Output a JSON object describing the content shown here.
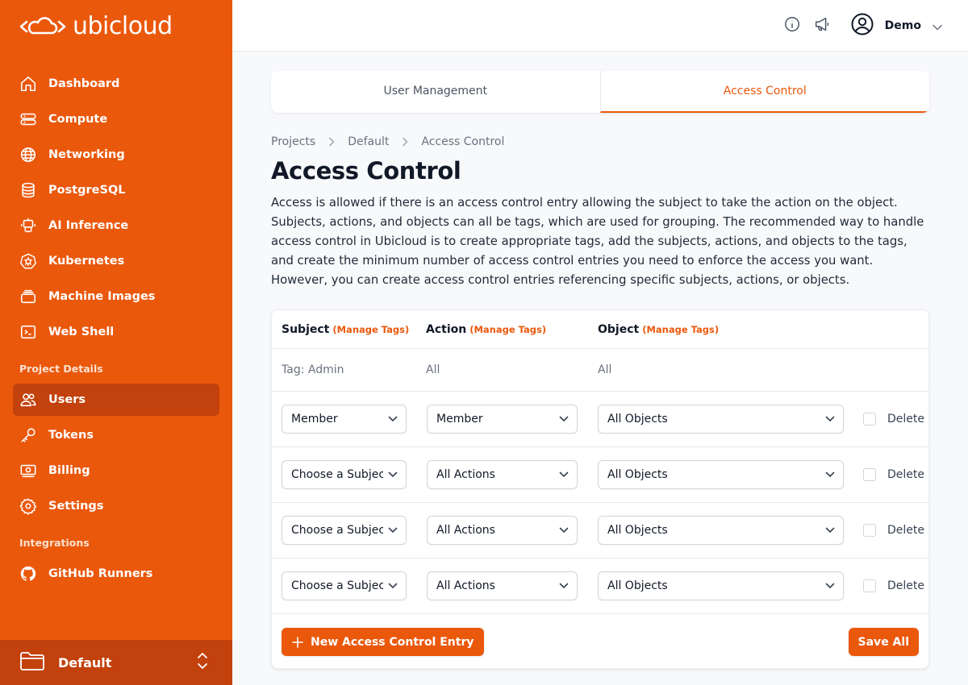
{
  "brand": {
    "name": "ubicloud"
  },
  "sidebar": {
    "items": [
      {
        "label": "Dashboard",
        "icon": "home-icon"
      },
      {
        "label": "Compute",
        "icon": "server-icon"
      },
      {
        "label": "Networking",
        "icon": "globe-icon"
      },
      {
        "label": "PostgreSQL",
        "icon": "database-icon"
      },
      {
        "label": "AI Inference",
        "icon": "robot-icon"
      },
      {
        "label": "Kubernetes",
        "icon": "kubernetes-icon"
      },
      {
        "label": "Machine Images",
        "icon": "stack-icon"
      },
      {
        "label": "Web Shell",
        "icon": "terminal-icon"
      }
    ],
    "project_details_title": "Project Details",
    "project_items": [
      {
        "label": "Users",
        "icon": "users-icon",
        "active": true
      },
      {
        "label": "Tokens",
        "icon": "key-icon"
      },
      {
        "label": "Billing",
        "icon": "banknote-icon"
      },
      {
        "label": "Settings",
        "icon": "gear-icon"
      }
    ],
    "integrations_title": "Integrations",
    "integration_items": [
      {
        "label": "GitHub Runners",
        "icon": "github-icon"
      }
    ],
    "project": {
      "name": "Default"
    }
  },
  "header": {
    "user_name": "Demo"
  },
  "tabs": [
    {
      "label": "User Management",
      "active": false
    },
    {
      "label": "Access Control",
      "active": true
    }
  ],
  "breadcrumb": [
    "Projects",
    "Default",
    "Access Control"
  ],
  "page": {
    "title": "Access Control",
    "description": "Access is allowed if there is an access control entry allowing the subject to take the action on the object. Subjects, actions, and objects can all be tags, which are used for grouping. The recommended way to handle access control in Ubicloud is to create appropriate tags, add the subjects, actions, and objects to the tags, and create the minimum number of access control entries you need to enforce the access you want. However, you can create access control entries referencing specific subjects, actions, or objects."
  },
  "table": {
    "columns": [
      {
        "label": "Subject",
        "manage": "(Manage Tags)"
      },
      {
        "label": "Action",
        "manage": "(Manage Tags)"
      },
      {
        "label": "Object",
        "manage": "(Manage Tags)"
      }
    ],
    "static_row": {
      "subject": "Tag: Admin",
      "action": "All",
      "object": "All"
    },
    "rows": [
      {
        "subject": "Member",
        "action": "Member",
        "object": "All Objects",
        "delete_label": "Delete"
      },
      {
        "subject": "Choose a Subject",
        "action": "All Actions",
        "object": "All Objects",
        "delete_label": "Delete"
      },
      {
        "subject": "Choose a Subject",
        "action": "All Actions",
        "object": "All Objects",
        "delete_label": "Delete"
      },
      {
        "subject": "Choose a Subject",
        "action": "All Actions",
        "object": "All Objects",
        "delete_label": "Delete"
      }
    ],
    "new_entry_label": "New Access Control Entry",
    "save_label": "Save All"
  },
  "colors": {
    "accent": "#ea580c",
    "accent_dark": "#c2410c"
  }
}
